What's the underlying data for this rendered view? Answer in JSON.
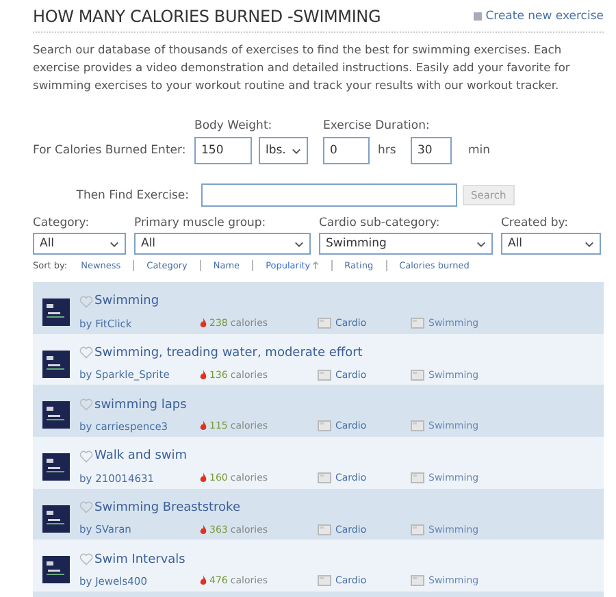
{
  "header": {
    "title": "HOW MANY CALORIES BURNED -SWIMMING",
    "create_link": "Create new exercise"
  },
  "description": "Search our database of thousands of exercises to find the best for swimming exercises. Each exercise provides a video demonstration and detailed instructions. Easily add your favorite for swimming exercises to your workout routine and track your results with our workout tracker.",
  "calculator": {
    "label": "For Calories Burned Enter:",
    "weight_label": "Body Weight:",
    "weight": "150",
    "unit": "lbs.",
    "duration_label": "Exercise Duration:",
    "hours": "0",
    "hours_unit": "hrs",
    "minutes": "30",
    "minutes_unit": "min"
  },
  "find": {
    "label": "Then Find Exercise:",
    "button": "Search"
  },
  "filters": [
    {
      "label": "Category:",
      "value": "All"
    },
    {
      "label": "Primary muscle group:",
      "value": "All"
    },
    {
      "label": "Cardio sub-category:",
      "value": "Swimming"
    },
    {
      "label": "Created by:",
      "value": "All"
    }
  ],
  "sort": {
    "label": "Sort by:",
    "options": [
      {
        "label": "Newness",
        "selected": false
      },
      {
        "label": "Category",
        "selected": false
      },
      {
        "label": "Name",
        "selected": false
      },
      {
        "label": "Popularity",
        "selected": true
      },
      {
        "label": "Rating",
        "selected": false
      },
      {
        "label": "Calories burned",
        "selected": false
      }
    ]
  },
  "exercises": [
    {
      "name": "Swimming",
      "author": "by FitClick",
      "calories": "238",
      "calories_unit": "calories",
      "category": "Cardio",
      "subcategory": "Swimming"
    },
    {
      "name": "Swimming, treading water, moderate effort",
      "author": "by Sparkle_Sprite",
      "calories": "136",
      "calories_unit": "calories",
      "category": "Cardio",
      "subcategory": "Swimming"
    },
    {
      "name": "swimming laps",
      "author": "by carriespence3",
      "calories": "115",
      "calories_unit": "calories",
      "category": "Cardio",
      "subcategory": "Swimming"
    },
    {
      "name": "Walk and swim",
      "author": "by 210014631",
      "calories": "160",
      "calories_unit": "calories",
      "category": "Cardio",
      "subcategory": "Swimming"
    },
    {
      "name": "Swimming Breaststroke",
      "author": "by SVaran",
      "calories": "363",
      "calories_unit": "calories",
      "category": "Cardio",
      "subcategory": "Swimming"
    },
    {
      "name": "Swim Intervals",
      "author": "by Jewels400",
      "calories": "476",
      "calories_unit": "calories",
      "category": "Cardio",
      "subcategory": "Swimming"
    }
  ]
}
